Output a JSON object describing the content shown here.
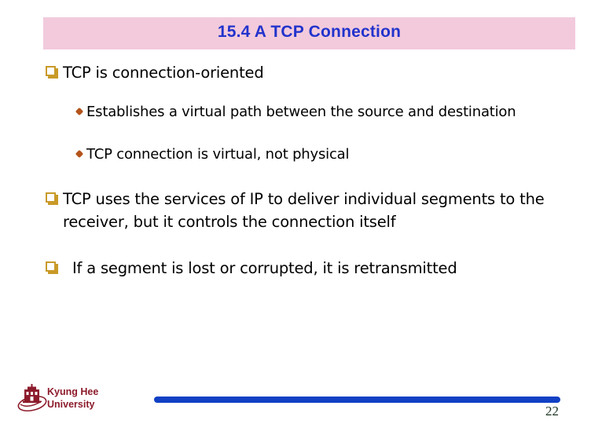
{
  "slide": {
    "title": "15.4 A TCP Connection",
    "title_color": "#2233CC",
    "title_bg_color": "#F2CADC",
    "background_color": "#FFFFFF",
    "bullets": [
      {
        "level": 1,
        "marker": "square-box-bullet",
        "text": "TCP is connection-oriented"
      },
      {
        "level": 2,
        "marker": "diamond-dot-bullet",
        "text": "Establishes a virtual path between the source and destination"
      },
      {
        "level": 2,
        "marker": "diamond-dot-bullet",
        "text": "TCP connection is virtual, not physical"
      },
      {
        "level": 1,
        "marker": "square-box-bullet",
        "text": "TCP uses the services of IP to deliver individual segments to the receiver, but it controls the connection itself"
      },
      {
        "level": 1,
        "marker": "square-box-bullet",
        "text": "If a segment is lost or corrupted, it is retransmitted"
      }
    ]
  },
  "footer": {
    "logo_line1": "Kyung Hee",
    "logo_line2": "University",
    "logo_text": "Kyung Hee\nUniversity",
    "logo_color": "#8C1B2B",
    "rule_color": "#1140C4",
    "page_number": "22"
  }
}
